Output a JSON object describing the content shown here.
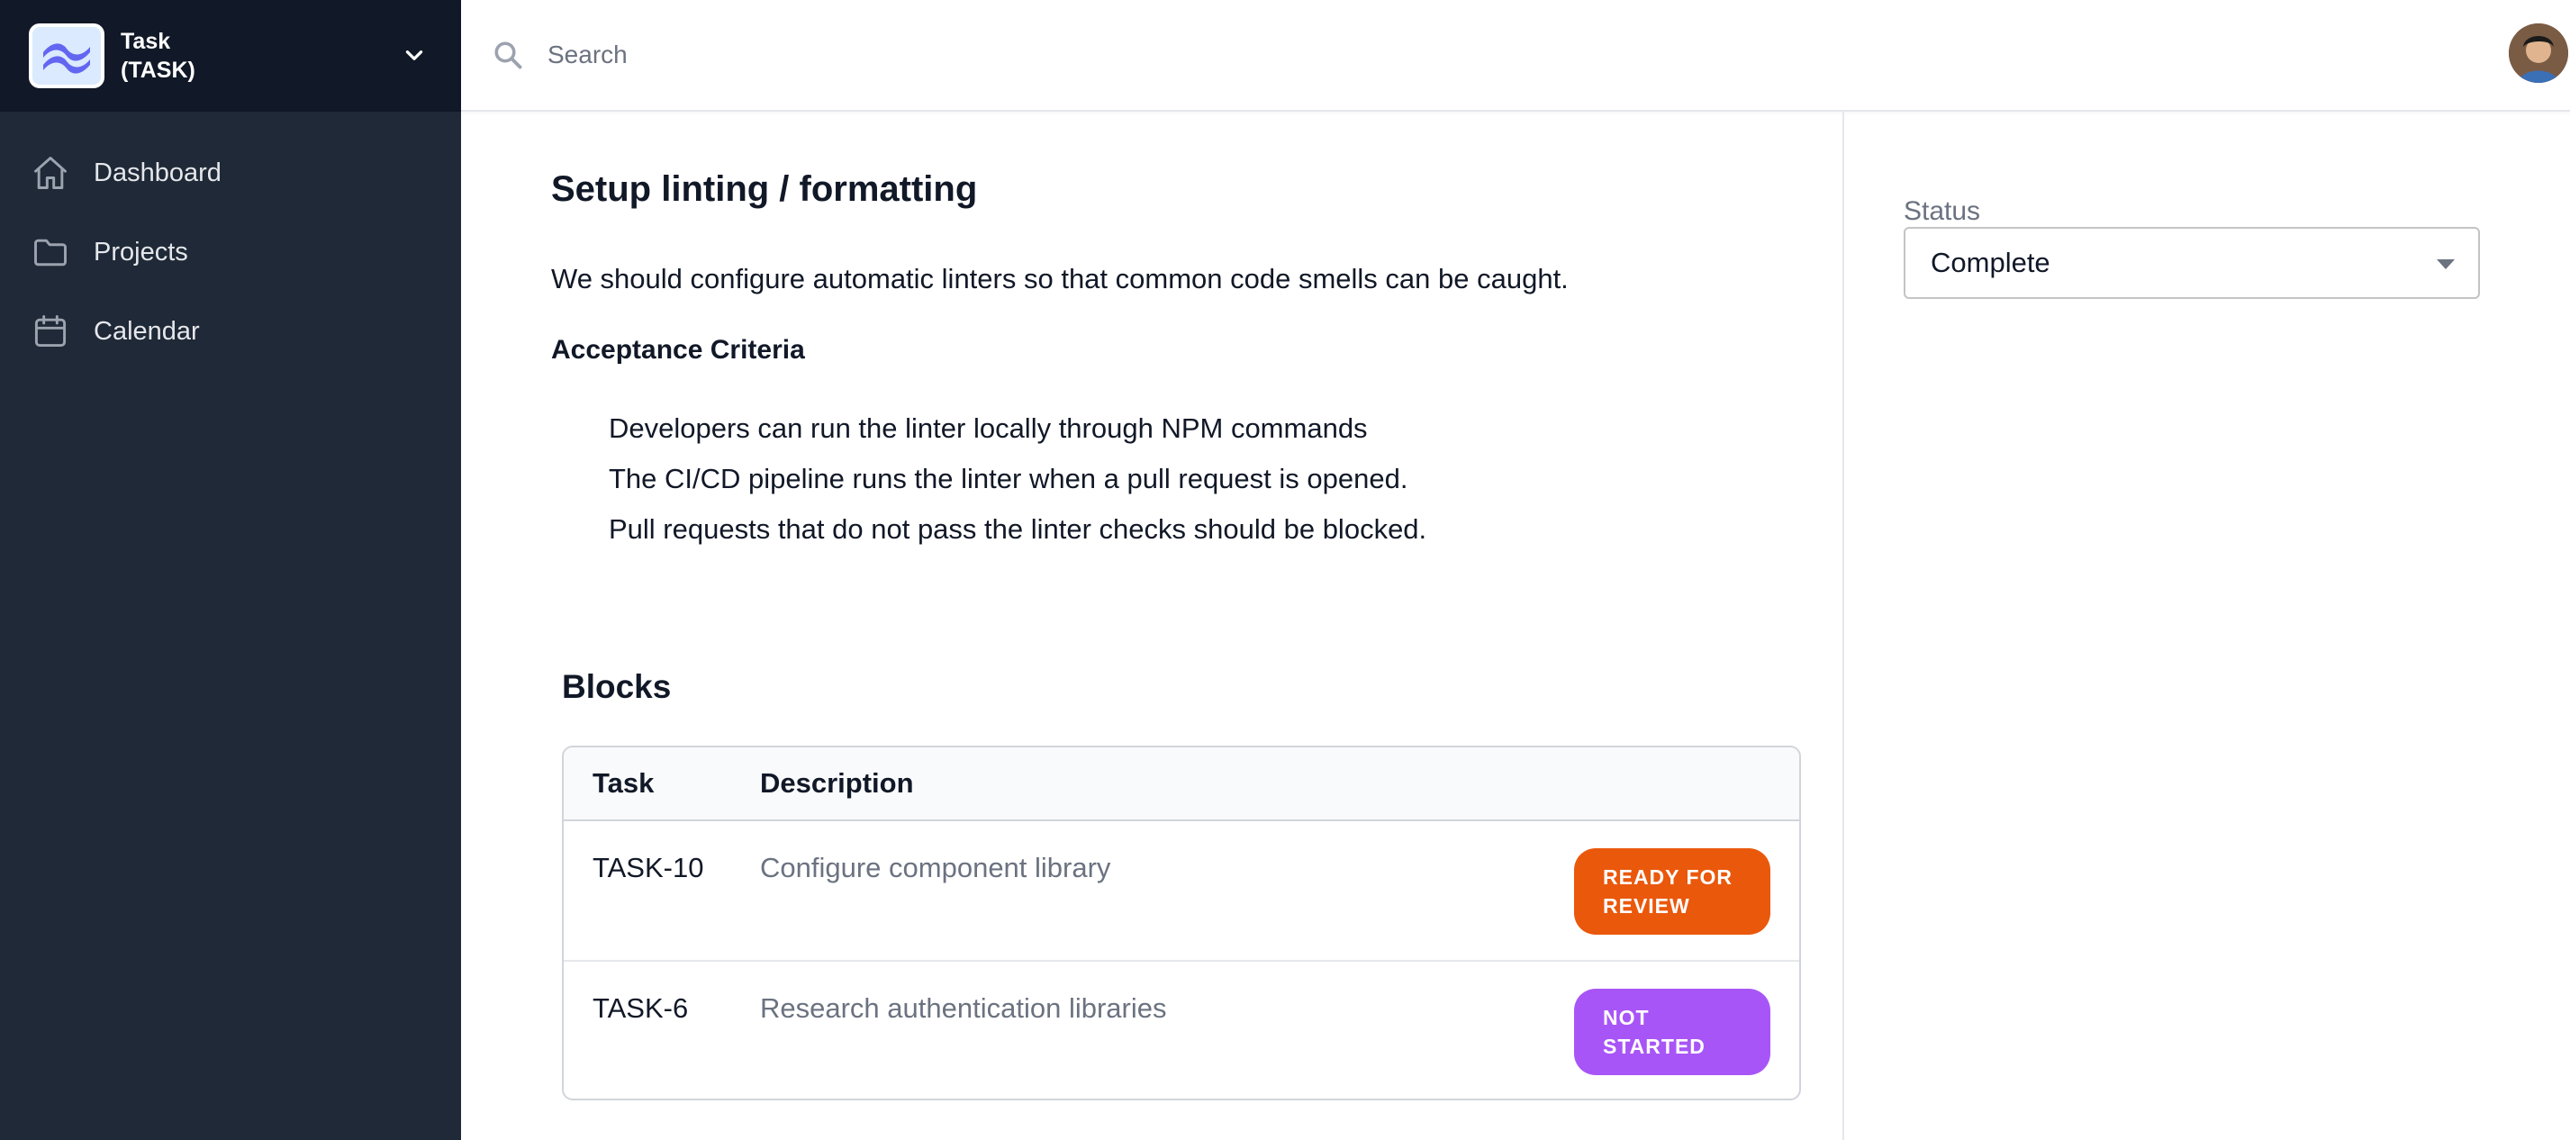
{
  "team": {
    "name_line1": "Task",
    "name_line2": "(TASK)",
    "logo_icon": "tailwind-wave-icon"
  },
  "sidebar": {
    "items": [
      {
        "label": "Dashboard",
        "icon": "home-icon"
      },
      {
        "label": "Projects",
        "icon": "folder-icon"
      },
      {
        "label": "Calendar",
        "icon": "calendar-icon"
      }
    ]
  },
  "search": {
    "placeholder": "Search",
    "value": ""
  },
  "task": {
    "title": "Setup linting / formatting",
    "description": "We should configure automatic linters so that common code smells can be caught.",
    "acceptance_heading": "Acceptance Criteria",
    "criteria": [
      "Developers can run the linter locally through NPM commands",
      "The CI/CD pipeline runs the linter when a pull request is opened.",
      "Pull requests that do not pass the linter checks should be blocked."
    ]
  },
  "blocks": {
    "heading": "Blocks",
    "columns": [
      "Task",
      "Description"
    ],
    "rows": [
      {
        "id": "TASK-10",
        "description": "Configure component library",
        "status": "READY FOR REVIEW",
        "status_color": "#ea580c"
      },
      {
        "id": "TASK-6",
        "description": "Research authentication libraries",
        "status": "NOT STARTED",
        "status_color": "#a855f7"
      }
    ]
  },
  "status_panel": {
    "label": "Status",
    "value": "Complete"
  },
  "colors": {
    "sidebar_bg": "#1f2937",
    "sidebar_header_bg": "#111827",
    "accent_logo": "#6366f1"
  }
}
